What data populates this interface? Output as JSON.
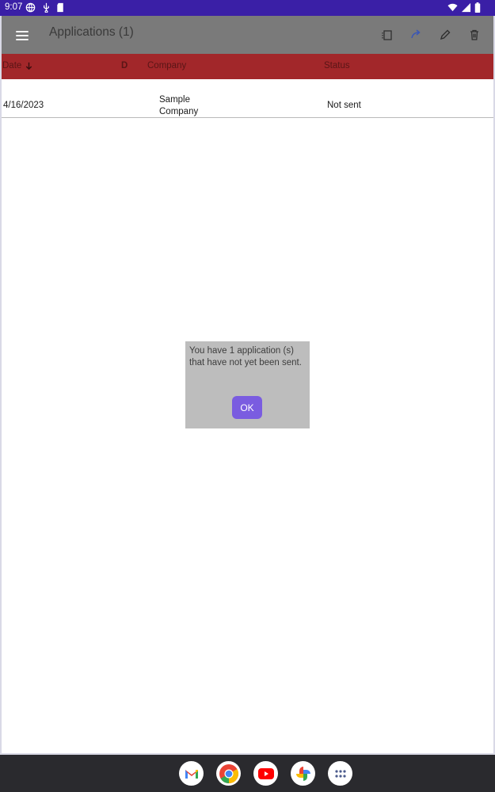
{
  "status_bar": {
    "time": "9:07",
    "icons_left": [
      "vpn-globe-icon",
      "usb-icon",
      "sd-card-icon"
    ],
    "icons_right": [
      "wifi-icon",
      "signal-icon",
      "battery-icon"
    ]
  },
  "toolbar": {
    "title": "Applications (1)",
    "actions": [
      "copy-icon",
      "send-icon",
      "edit-pencil-icon",
      "delete-trash-icon"
    ]
  },
  "table": {
    "columns": [
      "Date",
      "D",
      "Company",
      "Status"
    ],
    "sort_column": "Date",
    "sort_direction": "descending",
    "rows": [
      {
        "date": "4/16/2023",
        "company": "Sample Company",
        "status": "Not sent"
      }
    ]
  },
  "dialog": {
    "message": "You have 1 application (s) that have not yet been sent.",
    "ok_label": "OK"
  },
  "dock": {
    "apps": [
      "gmail-icon",
      "chrome-icon",
      "youtube-icon",
      "photos-icon",
      "app-drawer-icon"
    ]
  },
  "colors": {
    "status_bar": "#3a1fa6",
    "toolbar": "#7a7a7a",
    "table_header": "#a2272a",
    "dialog_bg": "#bdbdbd",
    "ok_button": "#7a5ce0",
    "dock": "#2a2a2e"
  }
}
